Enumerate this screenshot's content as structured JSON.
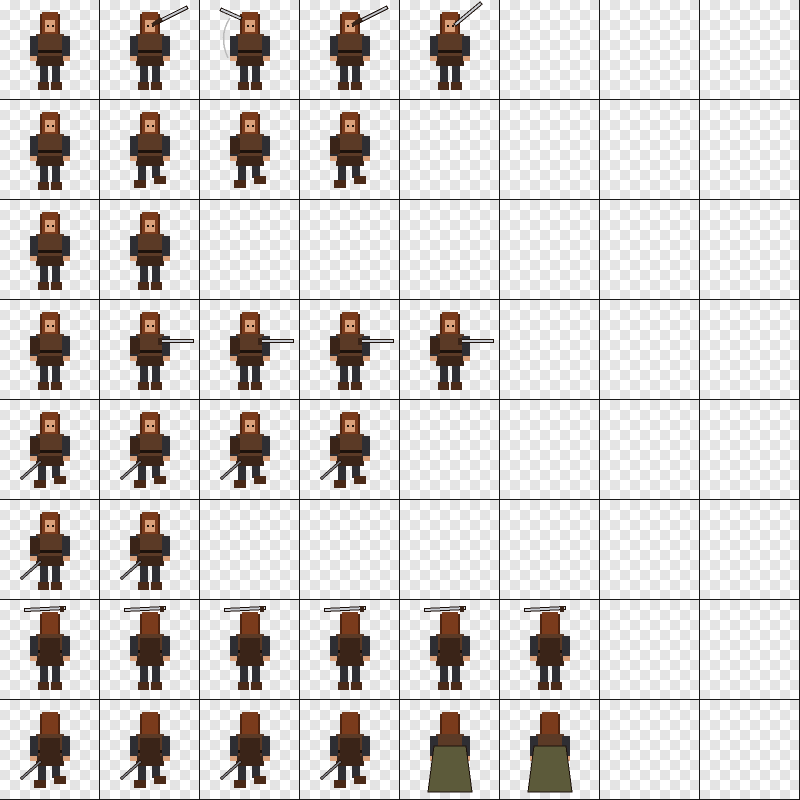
{
  "sprite_sheet": {
    "columns": 8,
    "rows": 8,
    "palette": {
      "hair": "#7a3b1c",
      "hair_dark": "#4e2410",
      "skin": "#d9a07a",
      "leather": "#5b3a26",
      "leather_dark": "#3a2418",
      "armor": "#2e2e33",
      "boot": "#4a2a18",
      "steel": "#c9ccd2",
      "steel_dark": "#7d8088",
      "cloak": "#5c5a3a",
      "outline": "#1d120c"
    },
    "animations": [
      {
        "row": 0,
        "name": "sword-attack-front",
        "frames": [
          {
            "pose": "idle-front",
            "sword": "none"
          },
          {
            "pose": "raise-front",
            "sword": "high-right"
          },
          {
            "pose": "swing-front",
            "sword": "high-left"
          },
          {
            "pose": "raise-front",
            "sword": "high-right"
          },
          {
            "pose": "swing-front",
            "sword": "overhead"
          }
        ]
      },
      {
        "row": 1,
        "name": "run-front",
        "frames": [
          {
            "pose": "idle-front",
            "sword": "none"
          },
          {
            "pose": "run-front",
            "sword": "none"
          },
          {
            "pose": "run-side",
            "sword": "none"
          },
          {
            "pose": "run-side",
            "sword": "none"
          }
        ]
      },
      {
        "row": 2,
        "name": "idle-front",
        "frames": [
          {
            "pose": "idle-front",
            "sword": "none"
          },
          {
            "pose": "idle-front",
            "sword": "none"
          }
        ]
      },
      {
        "row": 3,
        "name": "thrust-side",
        "frames": [
          {
            "pose": "thrust-side",
            "sword": "none"
          },
          {
            "pose": "thrust-side",
            "sword": "forward"
          },
          {
            "pose": "thrust-side",
            "sword": "forward"
          },
          {
            "pose": "thrust-side",
            "sword": "forward"
          },
          {
            "pose": "thrust-side",
            "sword": "forward"
          }
        ]
      },
      {
        "row": 4,
        "name": "walk-side",
        "frames": [
          {
            "pose": "walk-side",
            "sword": "sheathed"
          },
          {
            "pose": "walk-side",
            "sword": "sheathed"
          },
          {
            "pose": "walk-side",
            "sword": "sheathed"
          },
          {
            "pose": "walk-side",
            "sword": "sheathed"
          }
        ]
      },
      {
        "row": 5,
        "name": "idle-side",
        "frames": [
          {
            "pose": "idle-side",
            "sword": "sheathed"
          },
          {
            "pose": "idle-side",
            "sword": "sheathed"
          }
        ]
      },
      {
        "row": 6,
        "name": "sword-attack-back",
        "frames": [
          {
            "pose": "raise-back",
            "sword": "overhead-back"
          },
          {
            "pose": "raise-back",
            "sword": "overhead-back"
          },
          {
            "pose": "raise-back",
            "sword": "overhead-back"
          },
          {
            "pose": "raise-back",
            "sword": "overhead-back"
          },
          {
            "pose": "raise-back",
            "sword": "overhead-back"
          },
          {
            "pose": "raise-back",
            "sword": "overhead-back"
          }
        ]
      },
      {
        "row": 7,
        "name": "walk-back",
        "frames": [
          {
            "pose": "walk-back",
            "sword": "sheathed"
          },
          {
            "pose": "walk-back",
            "sword": "sheathed"
          },
          {
            "pose": "walk-back",
            "sword": "sheathed"
          },
          {
            "pose": "walk-back",
            "sword": "sheathed"
          },
          {
            "pose": "cloak-back",
            "sword": "none"
          },
          {
            "pose": "cloak-back",
            "sword": "none"
          }
        ]
      }
    ]
  }
}
